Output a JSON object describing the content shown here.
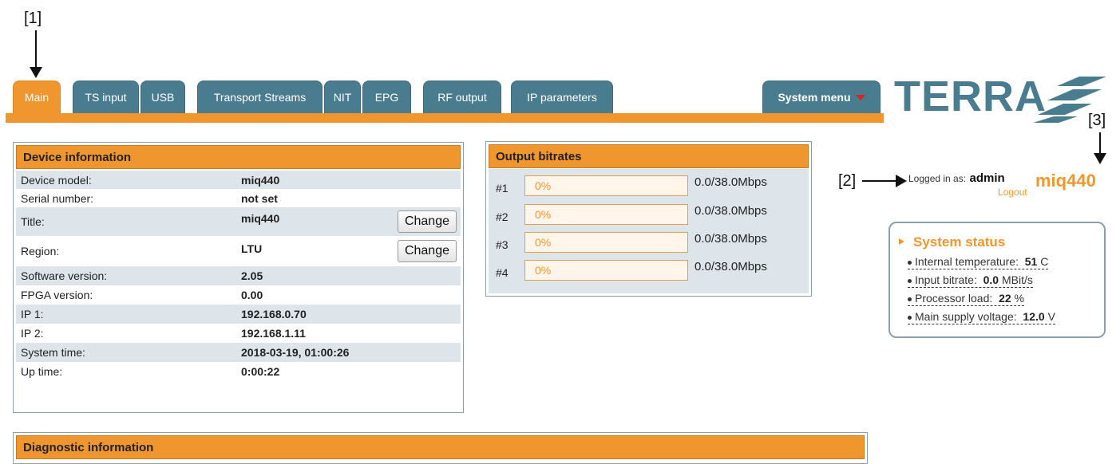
{
  "callouts": {
    "c1": "[1]",
    "c2": "[2]",
    "c3": "[3]"
  },
  "tabs": [
    {
      "label": "Main",
      "active": true
    },
    {
      "label": "TS input"
    },
    {
      "label": "USB"
    },
    {
      "label": "Transport Streams"
    },
    {
      "label": "NIT"
    },
    {
      "label": "EPG"
    },
    {
      "label": "RF output"
    },
    {
      "label": "IP parameters"
    }
  ],
  "system_menu": {
    "label": "System menu"
  },
  "logo": {
    "text": "TERRA"
  },
  "device_info": {
    "title": "Device information",
    "rows": [
      {
        "label": "Device model:",
        "value": "miq440"
      },
      {
        "label": "Serial number:",
        "value": "not set"
      },
      {
        "label": "Title:",
        "value": "miq440",
        "button": "Change"
      },
      {
        "label": "Region:",
        "value": "LTU",
        "button": "Change"
      },
      {
        "label": "Software version:",
        "value": "2.05"
      },
      {
        "label": "FPGA version:",
        "value": "0.00"
      },
      {
        "label": "IP 1:",
        "value": "192.168.0.70"
      },
      {
        "label": "IP 2:",
        "value": "192.168.1.11"
      },
      {
        "label": "System time:",
        "value": "2018-03-19, 01:00:26"
      },
      {
        "label": "Up time:",
        "value": "0:00:22"
      }
    ]
  },
  "output_bitrates": {
    "title": "Output bitrates",
    "rows": [
      {
        "num": "#1",
        "percent": "0%",
        "rate": "0.0/38.0Mbps"
      },
      {
        "num": "#2",
        "percent": "0%",
        "rate": "0.0/38.0Mbps"
      },
      {
        "num": "#3",
        "percent": "0%",
        "rate": "0.0/38.0Mbps"
      },
      {
        "num": "#4",
        "percent": "0%",
        "rate": "0.0/38.0Mbps"
      }
    ]
  },
  "login": {
    "label": "Logged in as:",
    "user": "admin",
    "logout": "Logout",
    "device": "miq440"
  },
  "system_status": {
    "title": "System status",
    "items": [
      {
        "label": "Internal temperature:",
        "value": "51",
        "unit": "C"
      },
      {
        "label": "Input bitrate:",
        "value": "0.0",
        "unit": "MBit/s"
      },
      {
        "label": "Processor load:",
        "value": "22",
        "unit": "%"
      },
      {
        "label": "Main supply voltage:",
        "value": "12.0",
        "unit": "V"
      }
    ]
  },
  "diagnostic": {
    "title": "Diagnostic information"
  },
  "colors": {
    "accent": "#f0962e",
    "tab": "#4a7c8f",
    "row_alt": "#dde5ea"
  }
}
